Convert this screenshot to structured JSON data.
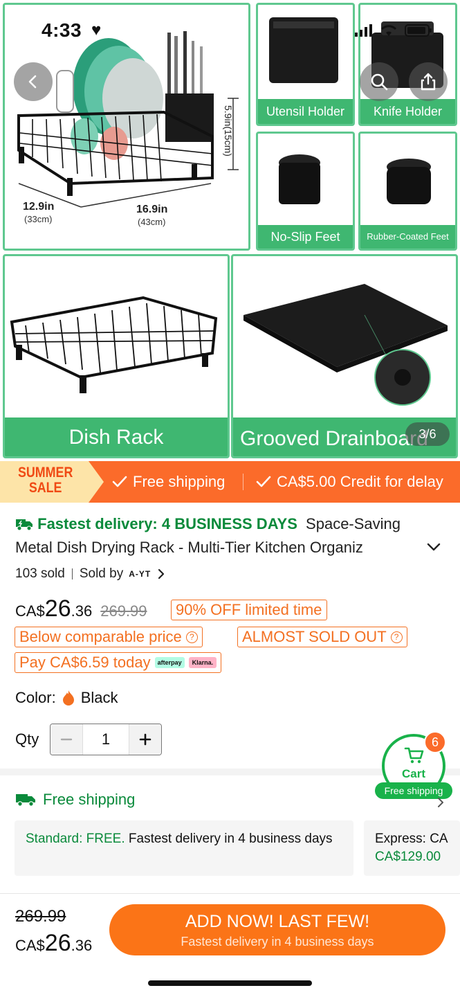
{
  "status_bar": {
    "time": "4:33"
  },
  "gallery": {
    "main_tile": {
      "dim_height": "5.9in(15cm)",
      "dim_depth": "12.9in",
      "dim_depth_cm": "(33cm)",
      "dim_width": "16.9in",
      "dim_width_cm": "(43cm)"
    },
    "tiles": {
      "utensil": "Utensil Holder",
      "knife": "Knife Holder",
      "noslip": "No-Slip Feet",
      "rubber": "Rubber-Coated Feet",
      "rack": "Dish Rack",
      "drain": "Grooved Drainboard"
    },
    "page_indicator": "3/6"
  },
  "promo": {
    "badge_line1": "SUMMER",
    "badge_line2": "SALE",
    "item1": "Free shipping",
    "item2": "CA$5.00 Credit for delay"
  },
  "product": {
    "fast_delivery": "Fastest delivery: 4 BUSINESS DAYS",
    "title_line1": "Space-Saving",
    "title_line2": "Metal Dish Drying Rack - Multi-Tier Kitchen Organiz",
    "sold_count": "103 sold",
    "sold_by": "Sold by",
    "brand": "A-YT",
    "price_currency": "CA$",
    "price_int": "26",
    "price_dec": ".36",
    "price_old": "269.99",
    "tag_off": "90% OFF limited time",
    "tag_below": "Below comparable price",
    "tag_almost": "ALMOST SOLD OUT",
    "tag_pay": "Pay CA$6.59 today",
    "afterpay": "afterpay",
    "klarna": "Klarna.",
    "color_label": "Color:",
    "color_value": "Black",
    "qty_label": "Qty",
    "qty_value": "1"
  },
  "cart": {
    "label": "Cart",
    "count": "6",
    "free_shipping": "Free shipping"
  },
  "shipping": {
    "heading": "Free shipping",
    "standard_label": "Standard: FREE.",
    "standard_text": "Fastest delivery in 4 business days",
    "express_label": "Express: CA",
    "express_price": "CA$129.00"
  },
  "bottom_bar": {
    "old_price": "269.99",
    "price_currency": "CA$",
    "price_int": "26",
    "price_dec": ".36",
    "cta_main": "ADD NOW! LAST FEW!",
    "cta_sub": "Fastest delivery in 4 business days"
  },
  "colors": {
    "accent_green": "#3fb771",
    "orange": "#fb6b2a",
    "brand_green": "#0a8a3b"
  }
}
